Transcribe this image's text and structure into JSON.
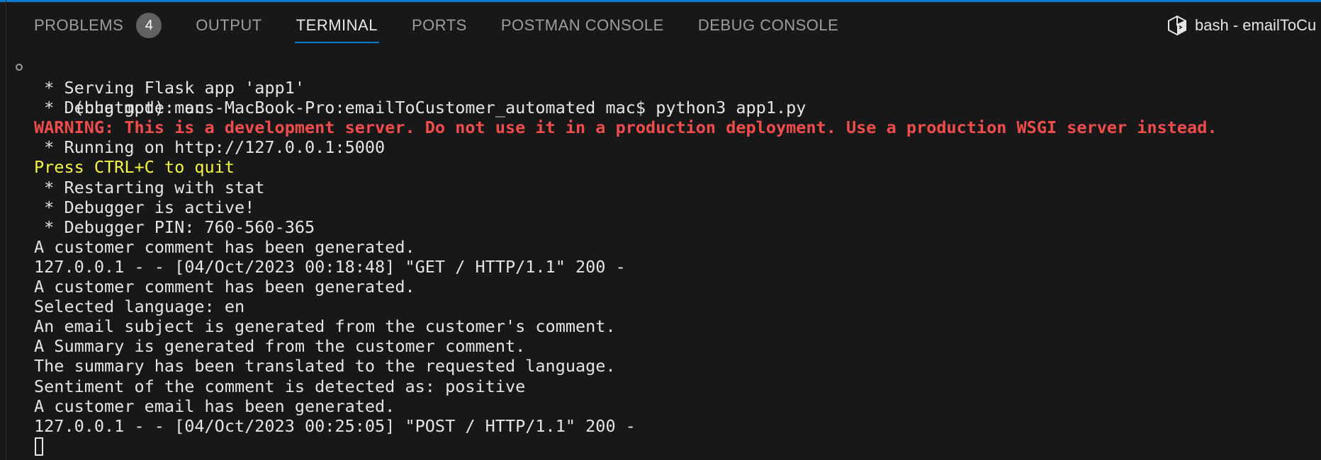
{
  "panel": {
    "tabs": [
      {
        "label": "PROBLEMS",
        "badge": "4"
      },
      {
        "label": "OUTPUT"
      },
      {
        "label": "TERMINAL",
        "active": true
      },
      {
        "label": "PORTS"
      },
      {
        "label": "POSTMAN CONSOLE"
      },
      {
        "label": "DEBUG CONSOLE"
      }
    ],
    "terminal_title": "bash - emailToCu",
    "terminal_title_icon": "terminal-cube-icon",
    "accent_color": "#0a7ad1"
  },
  "terminal": {
    "colors": {
      "text": "#e5e5e5",
      "warning": "#f14c4c",
      "hint": "#f5f543"
    },
    "lines": [
      "(chatgpt) macs-MacBook-Pro:emailToCustomer_automated mac$ python3 app1.py",
      " * Serving Flask app 'app1'",
      " * Debug mode: on",
      "WARNING: This is a development server. Do not use it in a production deployment. Use a production WSGI server instead.",
      " * Running on http://127.0.0.1:5000",
      "Press CTRL+C to quit",
      " * Restarting with stat",
      " * Debugger is active!",
      " * Debugger PIN: 760-560-365",
      "A customer comment has been generated.",
      "127.0.0.1 - - [04/Oct/2023 00:18:48] \"GET / HTTP/1.1\" 200 -",
      "A customer comment has been generated.",
      "Selected language: en",
      "An email subject is generated from the customer's comment.",
      "A Summary is generated from the customer comment.",
      "The summary has been translated to the requested language.",
      "Sentiment of the comment is detected as: positive",
      "A customer email has been generated.",
      "127.0.0.1 - - [04/Oct/2023 00:25:05] \"POST / HTTP/1.1\" 200 -"
    ]
  }
}
